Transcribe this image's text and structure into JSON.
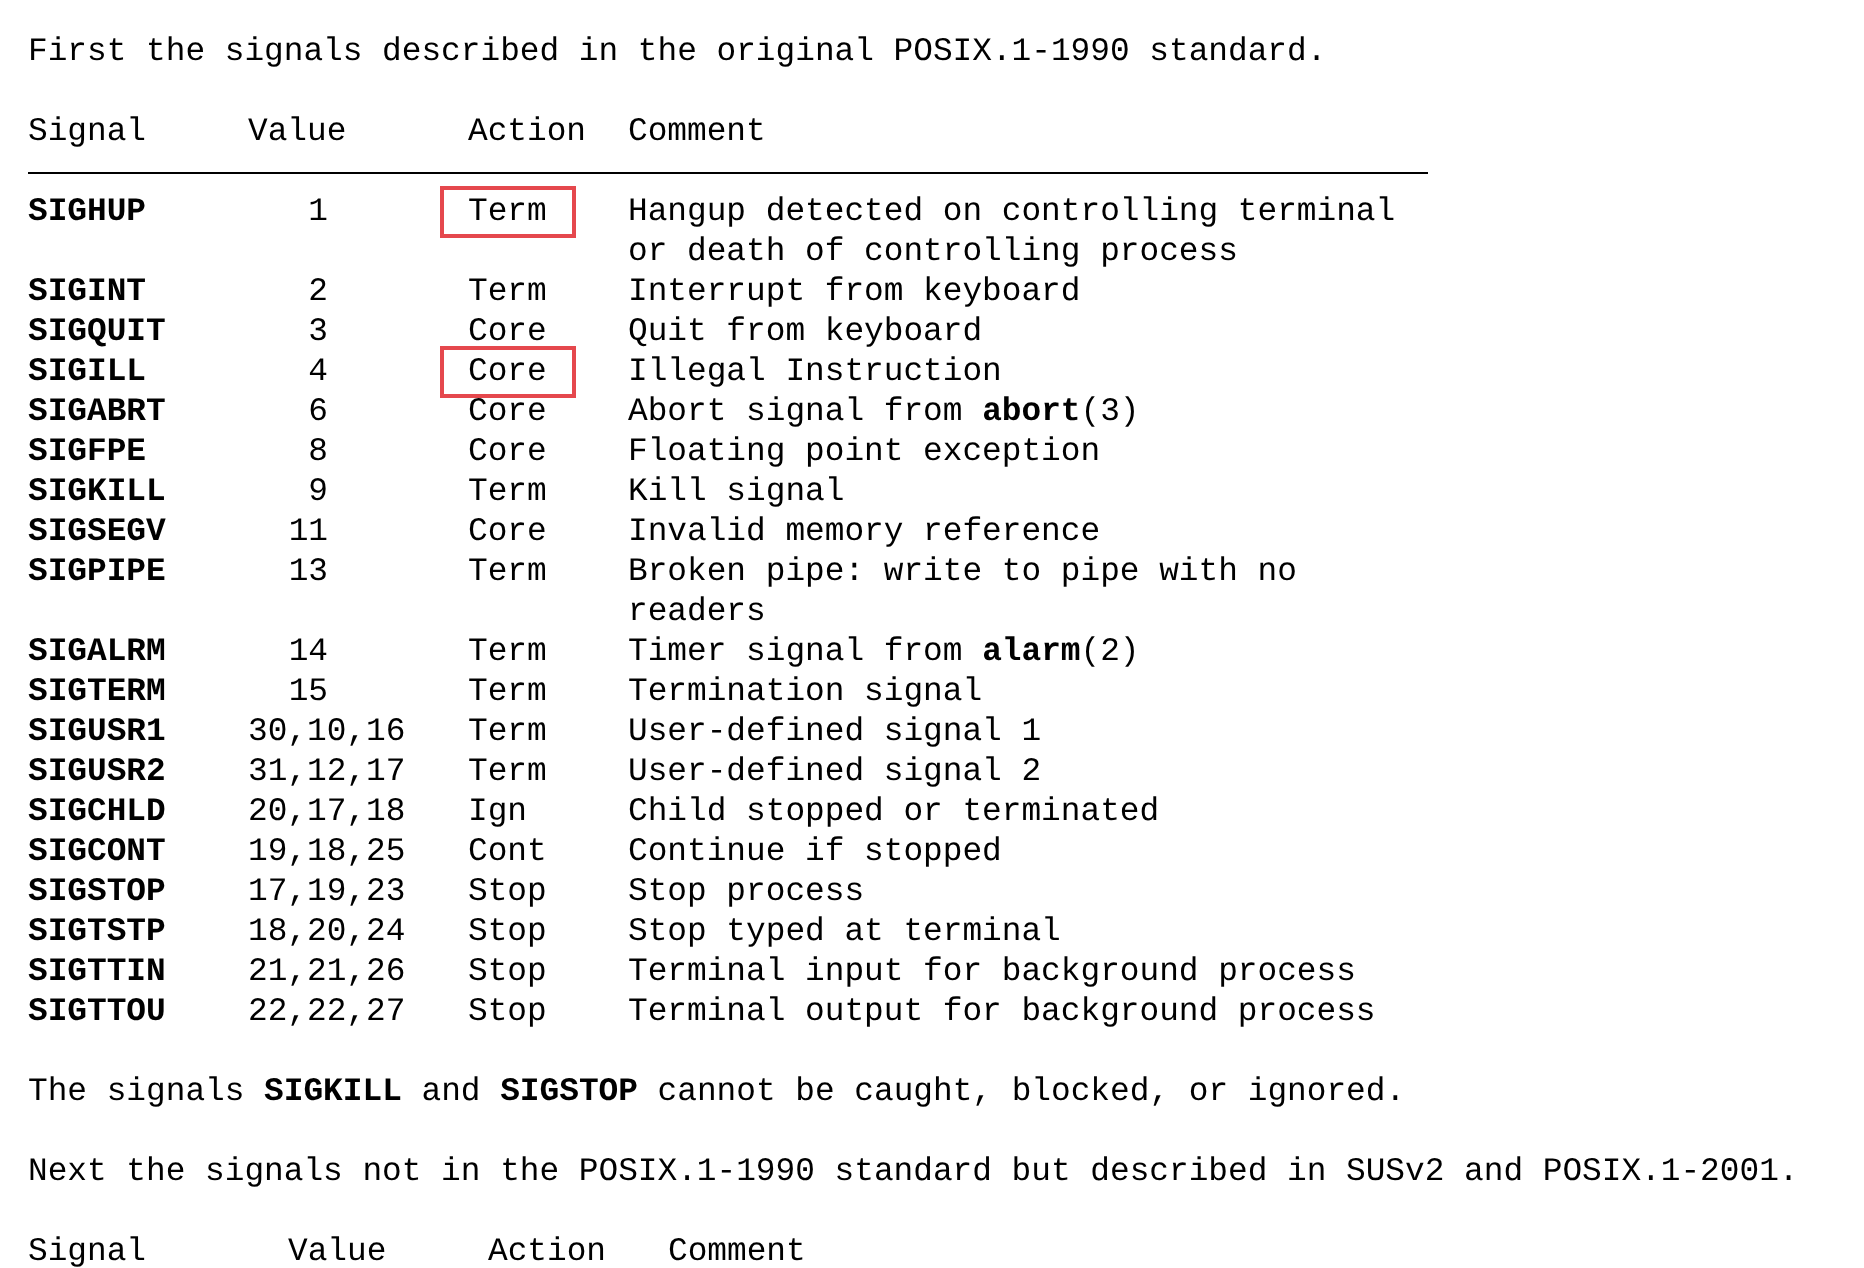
{
  "intro": "First the signals described in the original POSIX.1-1990 standard.",
  "table": {
    "columns": [
      "Signal",
      "Value",
      "Action",
      "Comment"
    ],
    "rows": [
      {
        "signal": "SIGHUP",
        "value": "1",
        "action": "Term",
        "highlighted": true,
        "comment": [
          "Hangup detected on controlling terminal",
          "or death of controlling process"
        ]
      },
      {
        "signal": "SIGINT",
        "value": "2",
        "action": "Term",
        "highlighted": false,
        "comment": [
          "Interrupt from keyboard"
        ]
      },
      {
        "signal": "SIGQUIT",
        "value": "3",
        "action": "Core",
        "highlighted": false,
        "comment": [
          "Quit from keyboard"
        ]
      },
      {
        "signal": "SIGILL",
        "value": "4",
        "action": "Core",
        "highlighted": true,
        "comment": [
          "Illegal Instruction"
        ]
      },
      {
        "signal": "SIGABRT",
        "value": "6",
        "action": "Core",
        "highlighted": false,
        "comment": [
          "Abort signal from **abort**(3)"
        ]
      },
      {
        "signal": "SIGFPE",
        "value": "8",
        "action": "Core",
        "highlighted": false,
        "comment": [
          "Floating point exception"
        ]
      },
      {
        "signal": "SIGKILL",
        "value": "9",
        "action": "Term",
        "highlighted": false,
        "comment": [
          "Kill signal"
        ]
      },
      {
        "signal": "SIGSEGV",
        "value": "11",
        "action": "Core",
        "highlighted": false,
        "comment": [
          "Invalid memory reference"
        ]
      },
      {
        "signal": "SIGPIPE",
        "value": "13",
        "action": "Term",
        "highlighted": false,
        "comment": [
          "Broken pipe: write to pipe with no",
          "readers"
        ]
      },
      {
        "signal": "SIGALRM",
        "value": "14",
        "action": "Term",
        "highlighted": false,
        "comment": [
          "Timer signal from **alarm**(2)"
        ]
      },
      {
        "signal": "SIGTERM",
        "value": "15",
        "action": "Term",
        "highlighted": false,
        "comment": [
          "Termination signal"
        ]
      },
      {
        "signal": "SIGUSR1",
        "value": "30,10,16",
        "action": "Term",
        "highlighted": false,
        "comment": [
          "User-defined signal 1"
        ]
      },
      {
        "signal": "SIGUSR2",
        "value": "31,12,17",
        "action": "Term",
        "highlighted": false,
        "comment": [
          "User-defined signal 2"
        ]
      },
      {
        "signal": "SIGCHLD",
        "value": "20,17,18",
        "action": "Ign",
        "highlighted": false,
        "comment": [
          "Child stopped or terminated"
        ]
      },
      {
        "signal": "SIGCONT",
        "value": "19,18,25",
        "action": "Cont",
        "highlighted": false,
        "comment": [
          "Continue if stopped"
        ]
      },
      {
        "signal": "SIGSTOP",
        "value": "17,19,23",
        "action": "Stop",
        "highlighted": false,
        "comment": [
          "Stop process"
        ]
      },
      {
        "signal": "SIGTSTP",
        "value": "18,20,24",
        "action": "Stop",
        "highlighted": false,
        "comment": [
          "Stop typed at terminal"
        ]
      },
      {
        "signal": "SIGTTIN",
        "value": "21,21,26",
        "action": "Stop",
        "highlighted": false,
        "comment": [
          "Terminal input for background process"
        ]
      },
      {
        "signal": "SIGTTOU",
        "value": "22,22,27",
        "action": "Stop",
        "highlighted": false,
        "comment": [
          "Terminal output for background process"
        ]
      }
    ]
  },
  "note": "The signals **SIGKILL** and **SIGSTOP** cannot be caught, blocked, or ignored.",
  "next_intro": "Next the signals not in the POSIX.1-1990 standard but described in SUSv2 and POSIX.1-2001.",
  "table2": {
    "columns": [
      "Signal",
      "Value",
      "Action",
      "Comment"
    ]
  }
}
